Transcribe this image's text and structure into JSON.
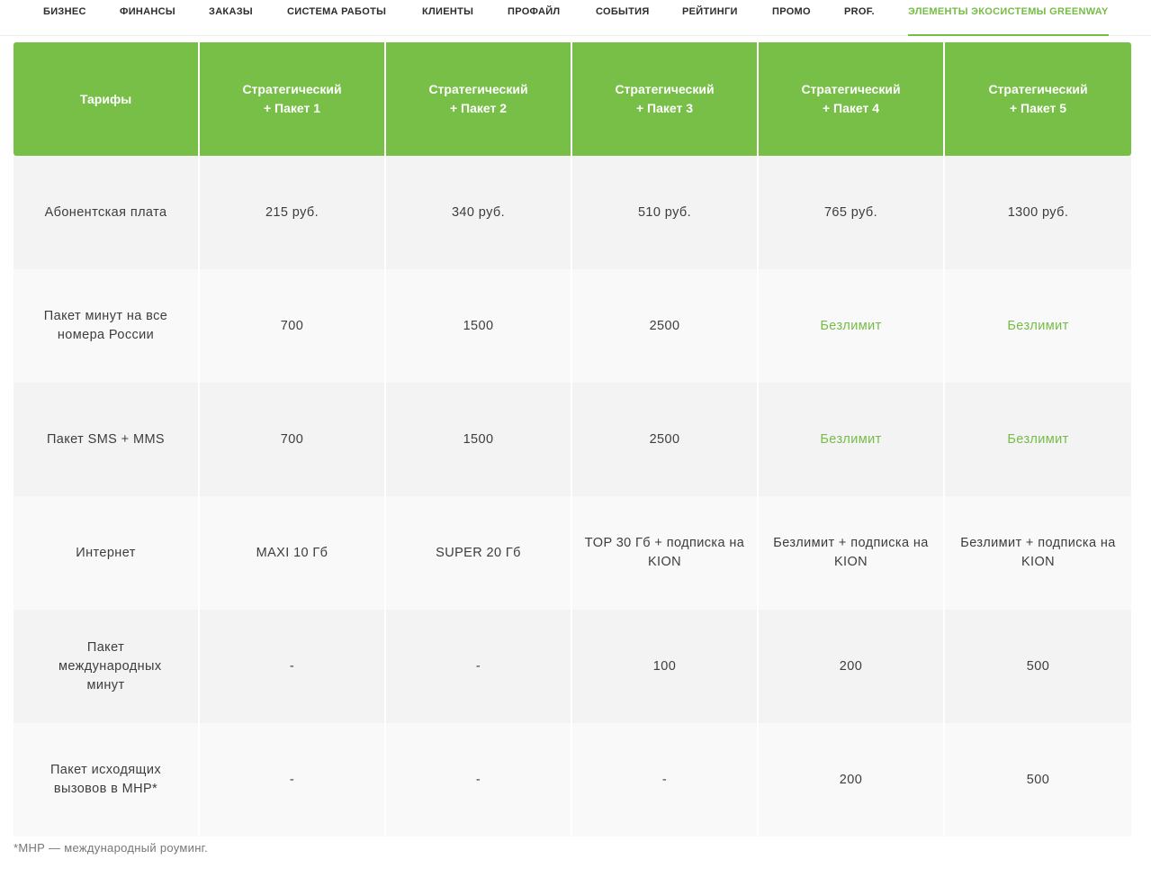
{
  "nav": {
    "items": [
      "БИЗНЕС",
      "ФИНАНСЫ",
      "ЗАКАЗЫ",
      "СИСТЕМА РАБОТЫ",
      "КЛИЕНТЫ",
      "ПРОФАЙЛ",
      "СОБЫТИЯ",
      "РЕЙТИНГИ",
      "ПРОМО",
      "PROF.",
      "ЭЛЕМЕНТЫ ЭКОСИСТЕМЫ GREENWAY"
    ],
    "active_index": 10
  },
  "table": {
    "corner_header": "Тарифы",
    "headers": [
      [
        "Стратегический",
        "+ Пакет 1"
      ],
      [
        "Стратегический",
        "+ Пакет 2"
      ],
      [
        "Стратегический",
        "+ Пакет 3"
      ],
      [
        "Стратегический",
        "+ Пакет 4"
      ],
      [
        "Стратегический",
        "+ Пакет 5"
      ]
    ],
    "rows": [
      {
        "label": "Абонентская плата",
        "cells": [
          "215 руб.",
          "340 руб.",
          "510 руб.",
          "765 руб.",
          "1300 руб."
        ]
      },
      {
        "label": "Пакет минут на все номера России",
        "cells": [
          "700",
          "1500",
          "2500",
          "Безлимит",
          "Безлимит"
        ]
      },
      {
        "label": "Пакет SMS + MMS",
        "cells": [
          "700",
          "1500",
          "2500",
          "Безлимит",
          "Безлимит"
        ]
      },
      {
        "label": "Интернет",
        "cells": [
          "MAXI 10 Гб",
          "SUPER 20 Гб",
          "TOP 30 Гб + подписка на KION",
          "Безлимит + подписка на KION",
          "Безлимит + подписка на KION"
        ]
      },
      {
        "label": "Пакет международных минут",
        "cells": [
          "-",
          "-",
          "100",
          "200",
          "500"
        ]
      },
      {
        "label": "Пакет исходящих вызовов в МНР*",
        "cells": [
          "-",
          "-",
          "-",
          "200",
          "500"
        ]
      }
    ]
  },
  "footnote": "*МНР — международный роуминг.",
  "colors": {
    "accent": "#77bf47",
    "accent_text": "#76bc45",
    "row_odd": "#f3f3f3",
    "row_even": "#f9f9f9"
  }
}
